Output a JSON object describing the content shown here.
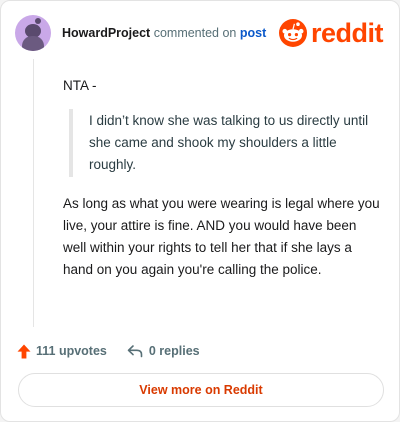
{
  "header": {
    "username": "HowardProject",
    "action_text": "commented on",
    "post_link": "post",
    "logo_text": "reddit",
    "avatar_icon": "snoo-avatar-icon",
    "brand_color": "#ff4500"
  },
  "comment": {
    "intro": "NTA -",
    "quote": "I didn’t know she was talking to us directly until she came and shook my shoulders a little roughly.",
    "body": "As long as what you were wearing is legal where you live, your attire is fine. AND you would have been well within your rights to tell her that if she lays a hand on you again you're calling the police."
  },
  "footer": {
    "upvotes": "111 upvotes",
    "replies": "0 replies",
    "upvote_icon": "upvote-arrow-icon",
    "reply_icon": "reply-arrow-icon"
  },
  "cta": {
    "label": "View more on Reddit",
    "color": "#d93a00"
  }
}
